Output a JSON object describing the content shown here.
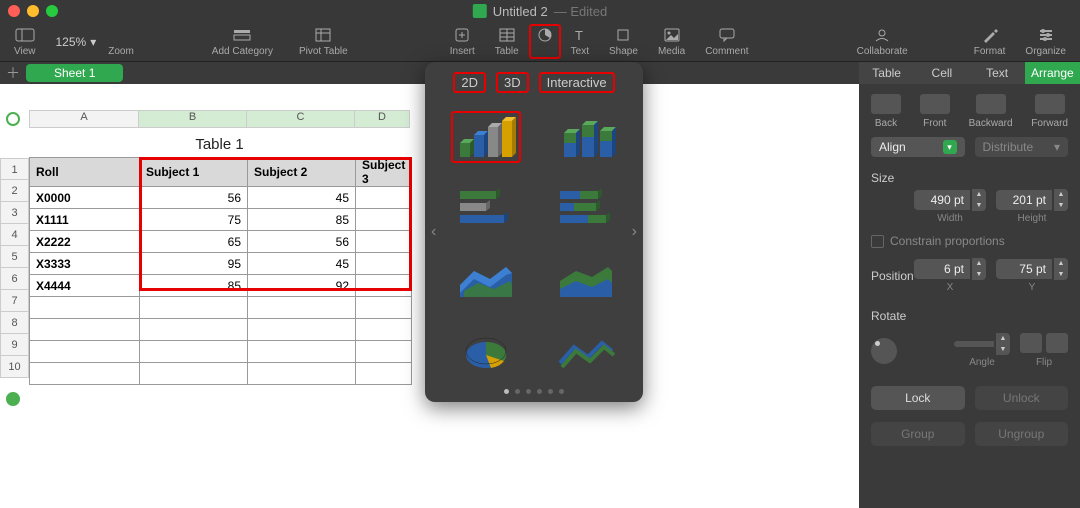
{
  "window": {
    "title": "Untitled 2",
    "edited": "— Edited"
  },
  "toolbar": {
    "view": "View",
    "zoom": "Zoom",
    "zoom_pct": "125%",
    "add_category": "Add Category",
    "pivot_table": "Pivot Table",
    "insert": "Insert",
    "table": "Table",
    "chart": "Chart",
    "text": "Text",
    "shape": "Shape",
    "media": "Media",
    "comment": "Comment",
    "collaborate": "Collaborate",
    "format": "Format",
    "organize": "Organize"
  },
  "sheet_tab": "Sheet 1",
  "columns": {
    "a": "A",
    "b": "B",
    "c": "C",
    "d": "D"
  },
  "rows": [
    "1",
    "2",
    "3",
    "4",
    "5",
    "6",
    "7",
    "8",
    "9",
    "10"
  ],
  "table": {
    "title": "Table 1",
    "headers": {
      "roll": "Roll",
      "s1": "Subject 1",
      "s2": "Subject 2",
      "s3": "Subject 3"
    },
    "data": [
      {
        "roll": "X0000",
        "s1": "56",
        "s2": "45",
        "s3": ""
      },
      {
        "roll": "X1111",
        "s1": "75",
        "s2": "85",
        "s3": ""
      },
      {
        "roll": "X2222",
        "s1": "65",
        "s2": "56",
        "s3": ""
      },
      {
        "roll": "X3333",
        "s1": "95",
        "s2": "45",
        "s3": ""
      },
      {
        "roll": "X4444",
        "s1": "85",
        "s2": "92",
        "s3": ""
      }
    ]
  },
  "chart_popover": {
    "tabs": {
      "d2": "2D",
      "d3": "3D",
      "interactive": "Interactive"
    }
  },
  "inspector": {
    "tabs": {
      "table": "Table",
      "cell": "Cell",
      "text": "Text",
      "arrange": "Arrange"
    },
    "move": {
      "back": "Back",
      "front": "Front",
      "backward": "Backward",
      "forward": "Forward"
    },
    "align": "Align",
    "distribute": "Distribute",
    "size": "Size",
    "width_val": "490 pt",
    "width_lbl": "Width",
    "height_val": "201 pt",
    "height_lbl": "Height",
    "constrain": "Constrain proportions",
    "position": "Position",
    "x_val": "6 pt",
    "x_lbl": "X",
    "y_val": "75 pt",
    "y_lbl": "Y",
    "rotate": "Rotate",
    "angle": "Angle",
    "flip": "Flip",
    "lock": "Lock",
    "unlock": "Unlock",
    "group": "Group",
    "ungroup": "Ungroup"
  }
}
